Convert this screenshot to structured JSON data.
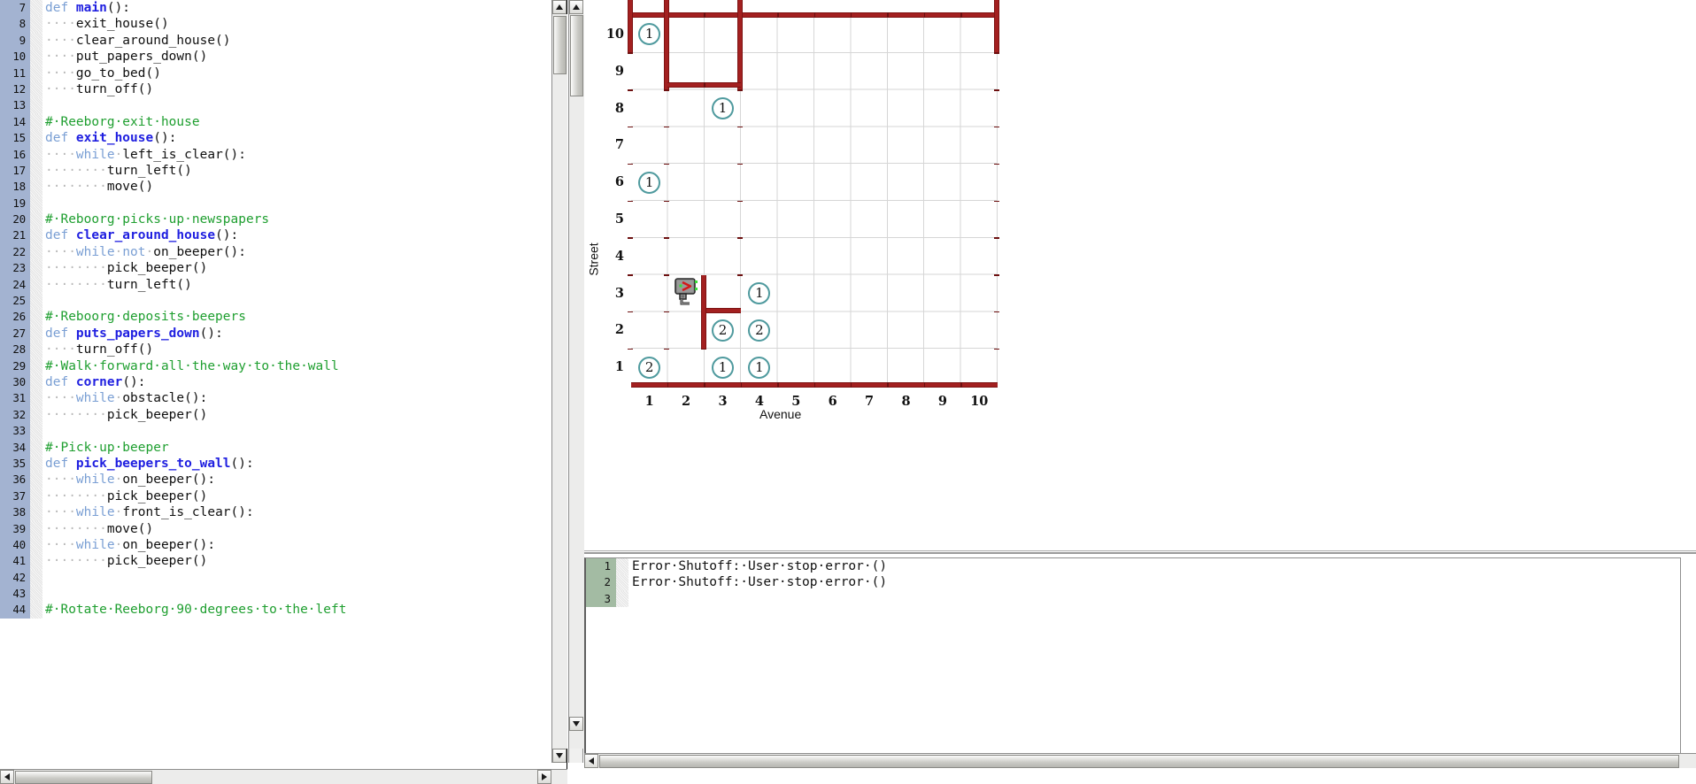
{
  "editor": {
    "start_line": 7,
    "lines": [
      {
        "n": 7,
        "tokens": [
          {
            "t": "def ",
            "c": "kw"
          },
          {
            "t": "main",
            "c": "fname"
          },
          {
            "t": "():",
            "c": "plain"
          }
        ]
      },
      {
        "n": 8,
        "tokens": [
          {
            "t": "····",
            "c": "dot"
          },
          {
            "t": "exit_house()",
            "c": "plain"
          }
        ]
      },
      {
        "n": 9,
        "tokens": [
          {
            "t": "····",
            "c": "dot"
          },
          {
            "t": "clear_around_house()",
            "c": "plain"
          }
        ]
      },
      {
        "n": 10,
        "tokens": [
          {
            "t": "····",
            "c": "dot"
          },
          {
            "t": "put_papers_down()",
            "c": "plain"
          }
        ]
      },
      {
        "n": 11,
        "tokens": [
          {
            "t": "····",
            "c": "dot"
          },
          {
            "t": "go_to_bed()",
            "c": "plain"
          }
        ]
      },
      {
        "n": 12,
        "tokens": [
          {
            "t": "····",
            "c": "dot"
          },
          {
            "t": "turn_off()",
            "c": "plain"
          }
        ]
      },
      {
        "n": 13,
        "tokens": []
      },
      {
        "n": 14,
        "tokens": [
          {
            "t": "#·Reeborg·exit·house",
            "c": "comment"
          }
        ]
      },
      {
        "n": 15,
        "tokens": [
          {
            "t": "def ",
            "c": "kw"
          },
          {
            "t": "exit_house",
            "c": "fname"
          },
          {
            "t": "():",
            "c": "plain"
          }
        ]
      },
      {
        "n": 16,
        "tokens": [
          {
            "t": "····",
            "c": "dot"
          },
          {
            "t": "while",
            "c": "kw"
          },
          {
            "t": "·",
            "c": "dot"
          },
          {
            "t": "left_is_clear():",
            "c": "plain"
          }
        ]
      },
      {
        "n": 17,
        "tokens": [
          {
            "t": "········",
            "c": "dot"
          },
          {
            "t": "turn_left()",
            "c": "plain"
          }
        ]
      },
      {
        "n": 18,
        "tokens": [
          {
            "t": "········",
            "c": "dot"
          },
          {
            "t": "move()",
            "c": "plain"
          }
        ]
      },
      {
        "n": 19,
        "tokens": []
      },
      {
        "n": 20,
        "tokens": [
          {
            "t": "#·Reboorg·picks·up·newspapers",
            "c": "comment"
          }
        ]
      },
      {
        "n": 21,
        "tokens": [
          {
            "t": "def ",
            "c": "kw"
          },
          {
            "t": "clear_around_house",
            "c": "fname"
          },
          {
            "t": "():",
            "c": "plain"
          }
        ]
      },
      {
        "n": 22,
        "tokens": [
          {
            "t": "····",
            "c": "dot"
          },
          {
            "t": "while",
            "c": "kw"
          },
          {
            "t": "·",
            "c": "dot"
          },
          {
            "t": "not",
            "c": "kw"
          },
          {
            "t": "·",
            "c": "dot"
          },
          {
            "t": "on_beeper():",
            "c": "plain"
          }
        ]
      },
      {
        "n": 23,
        "tokens": [
          {
            "t": "········",
            "c": "dot"
          },
          {
            "t": "pick_beeper()",
            "c": "plain"
          }
        ]
      },
      {
        "n": 24,
        "tokens": [
          {
            "t": "········",
            "c": "dot"
          },
          {
            "t": "turn_left()",
            "c": "plain"
          }
        ]
      },
      {
        "n": 25,
        "tokens": []
      },
      {
        "n": 26,
        "tokens": [
          {
            "t": "#·Reboorg·deposits·beepers",
            "c": "comment"
          }
        ]
      },
      {
        "n": 27,
        "tokens": [
          {
            "t": "def ",
            "c": "kw"
          },
          {
            "t": "puts_papers_down",
            "c": "fname"
          },
          {
            "t": "():",
            "c": "plain"
          }
        ]
      },
      {
        "n": 28,
        "tokens": [
          {
            "t": "····",
            "c": "dot"
          },
          {
            "t": "turn_off()",
            "c": "plain"
          }
        ]
      },
      {
        "n": 29,
        "tokens": [
          {
            "t": "#·Walk·forward·all·the·way·to·the·wall",
            "c": "comment"
          }
        ]
      },
      {
        "n": 30,
        "tokens": [
          {
            "t": "def ",
            "c": "kw"
          },
          {
            "t": "corner",
            "c": "fname"
          },
          {
            "t": "():",
            "c": "plain"
          }
        ]
      },
      {
        "n": 31,
        "tokens": [
          {
            "t": "····",
            "c": "dot"
          },
          {
            "t": "while",
            "c": "kw"
          },
          {
            "t": "·",
            "c": "dot"
          },
          {
            "t": "obstacle():",
            "c": "plain"
          }
        ]
      },
      {
        "n": 32,
        "tokens": [
          {
            "t": "········",
            "c": "dot"
          },
          {
            "t": "pick_beeper()",
            "c": "plain"
          }
        ]
      },
      {
        "n": 33,
        "tokens": []
      },
      {
        "n": 34,
        "tokens": [
          {
            "t": "#·Pick·up·beeper",
            "c": "comment"
          }
        ]
      },
      {
        "n": 35,
        "tokens": [
          {
            "t": "def ",
            "c": "kw"
          },
          {
            "t": "pick_beepers_to_wall",
            "c": "fname"
          },
          {
            "t": "():",
            "c": "plain"
          }
        ]
      },
      {
        "n": 36,
        "tokens": [
          {
            "t": "····",
            "c": "dot"
          },
          {
            "t": "while",
            "c": "kw"
          },
          {
            "t": "·",
            "c": "dot"
          },
          {
            "t": "on_beeper():",
            "c": "plain"
          }
        ]
      },
      {
        "n": 37,
        "tokens": [
          {
            "t": "········",
            "c": "dot"
          },
          {
            "t": "pick_beeper()",
            "c": "plain"
          }
        ]
      },
      {
        "n": 38,
        "tokens": [
          {
            "t": "····",
            "c": "dot"
          },
          {
            "t": "while",
            "c": "kw"
          },
          {
            "t": "·",
            "c": "dot"
          },
          {
            "t": "front_is_clear():",
            "c": "plain"
          }
        ]
      },
      {
        "n": 39,
        "tokens": [
          {
            "t": "········",
            "c": "dot"
          },
          {
            "t": "move()",
            "c": "plain"
          }
        ]
      },
      {
        "n": 40,
        "tokens": [
          {
            "t": "····",
            "c": "dot"
          },
          {
            "t": "while",
            "c": "kw"
          },
          {
            "t": "·",
            "c": "dot"
          },
          {
            "t": "on_beeper():",
            "c": "plain"
          }
        ]
      },
      {
        "n": 41,
        "tokens": [
          {
            "t": "········",
            "c": "dot"
          },
          {
            "t": "pick_beeper()",
            "c": "plain"
          }
        ]
      },
      {
        "n": 42,
        "tokens": []
      },
      {
        "n": 43,
        "tokens": []
      },
      {
        "n": 44,
        "tokens": [
          {
            "t": "#·Rotate·Reeborg·90·degrees·to·the·left",
            "c": "comment"
          }
        ]
      }
    ]
  },
  "world": {
    "axis_x_label": "Avenue",
    "axis_y_label": "Street",
    "x_ticks": [
      "1",
      "2",
      "3",
      "4",
      "5",
      "6",
      "7",
      "8",
      "9",
      "10"
    ],
    "y_ticks": [
      "1",
      "2",
      "3",
      "4",
      "5",
      "6",
      "7",
      "8",
      "9",
      "10"
    ],
    "robot": {
      "avenue": 2,
      "street": 3,
      "orientation": "east"
    },
    "beepers": [
      {
        "avenue": 1,
        "street": 10,
        "count": "1"
      },
      {
        "avenue": 3,
        "street": 8,
        "count": "1"
      },
      {
        "avenue": 1,
        "street": 6,
        "count": "1"
      },
      {
        "avenue": 4,
        "street": 3,
        "count": "1"
      },
      {
        "avenue": 3,
        "street": 2,
        "count": "2"
      },
      {
        "avenue": 4,
        "street": 2,
        "count": "2"
      },
      {
        "avenue": 1,
        "street": 1,
        "count": "2"
      },
      {
        "avenue": 3,
        "street": 1,
        "count": "1"
      },
      {
        "avenue": 4,
        "street": 1,
        "count": "1"
      }
    ],
    "wall_color": "#a32020",
    "beeper_color": "#4f9a9e"
  },
  "console": {
    "lines": [
      {
        "n": 1,
        "text": "Error·Shutoff:·User·stop·error·()"
      },
      {
        "n": 2,
        "text": "Error·Shutoff:·User·stop·error·()"
      },
      {
        "n": 3,
        "text": ""
      }
    ]
  }
}
